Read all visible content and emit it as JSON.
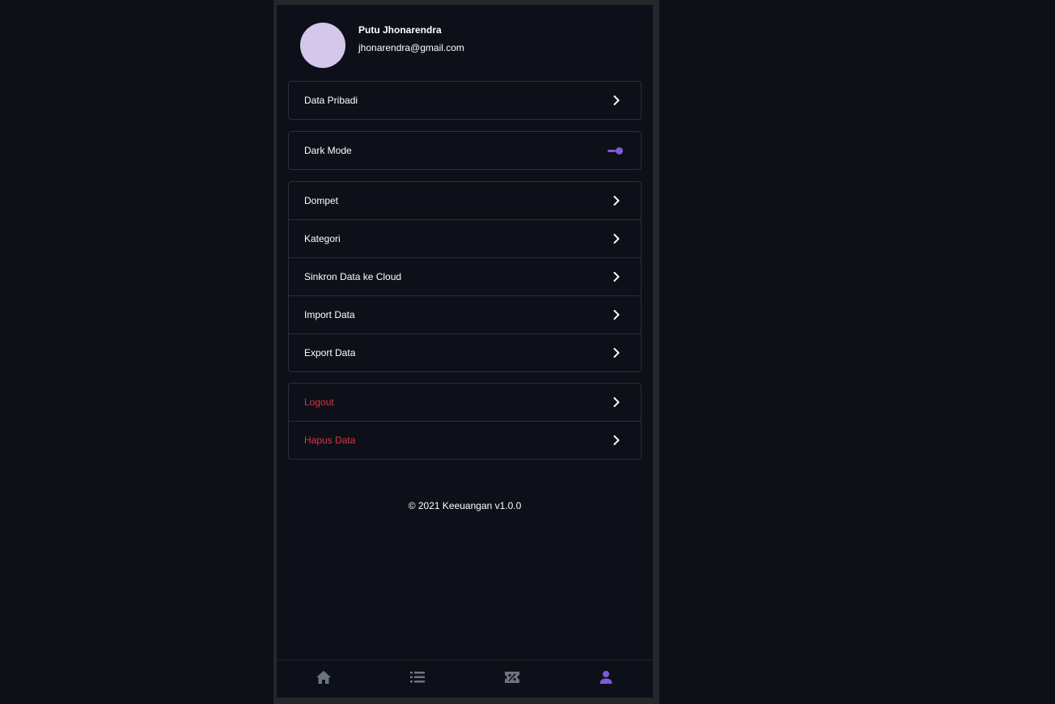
{
  "profile": {
    "name": "Putu Jhonarendra",
    "email": "jhonarendra@gmail.com",
    "avatar_color": "#d4c7eb"
  },
  "menu": {
    "personal": {
      "label": "Data Pribadi"
    },
    "dark_mode": {
      "label": "Dark Mode",
      "enabled": true
    },
    "wallet": {
      "label": "Dompet"
    },
    "category": {
      "label": "Kategori"
    },
    "sync": {
      "label": "Sinkron Data ke Cloud"
    },
    "import": {
      "label": "Import Data"
    },
    "export": {
      "label": "Export Data"
    },
    "logout": {
      "label": "Logout"
    },
    "delete": {
      "label": "Hapus Data"
    }
  },
  "footer": {
    "text": "© 2021 Keeuangan v1.0.0"
  },
  "bottom_nav": {
    "items": [
      {
        "icon": "home-icon",
        "active": false
      },
      {
        "icon": "list-icon",
        "active": false
      },
      {
        "icon": "discount-ticket-icon",
        "active": false
      },
      {
        "icon": "user-icon",
        "active": true
      }
    ]
  },
  "colors": {
    "background": "#0d1018",
    "accent": "#7e5bd6",
    "danger": "#dc3545",
    "nav_inactive": "#6c757d"
  }
}
